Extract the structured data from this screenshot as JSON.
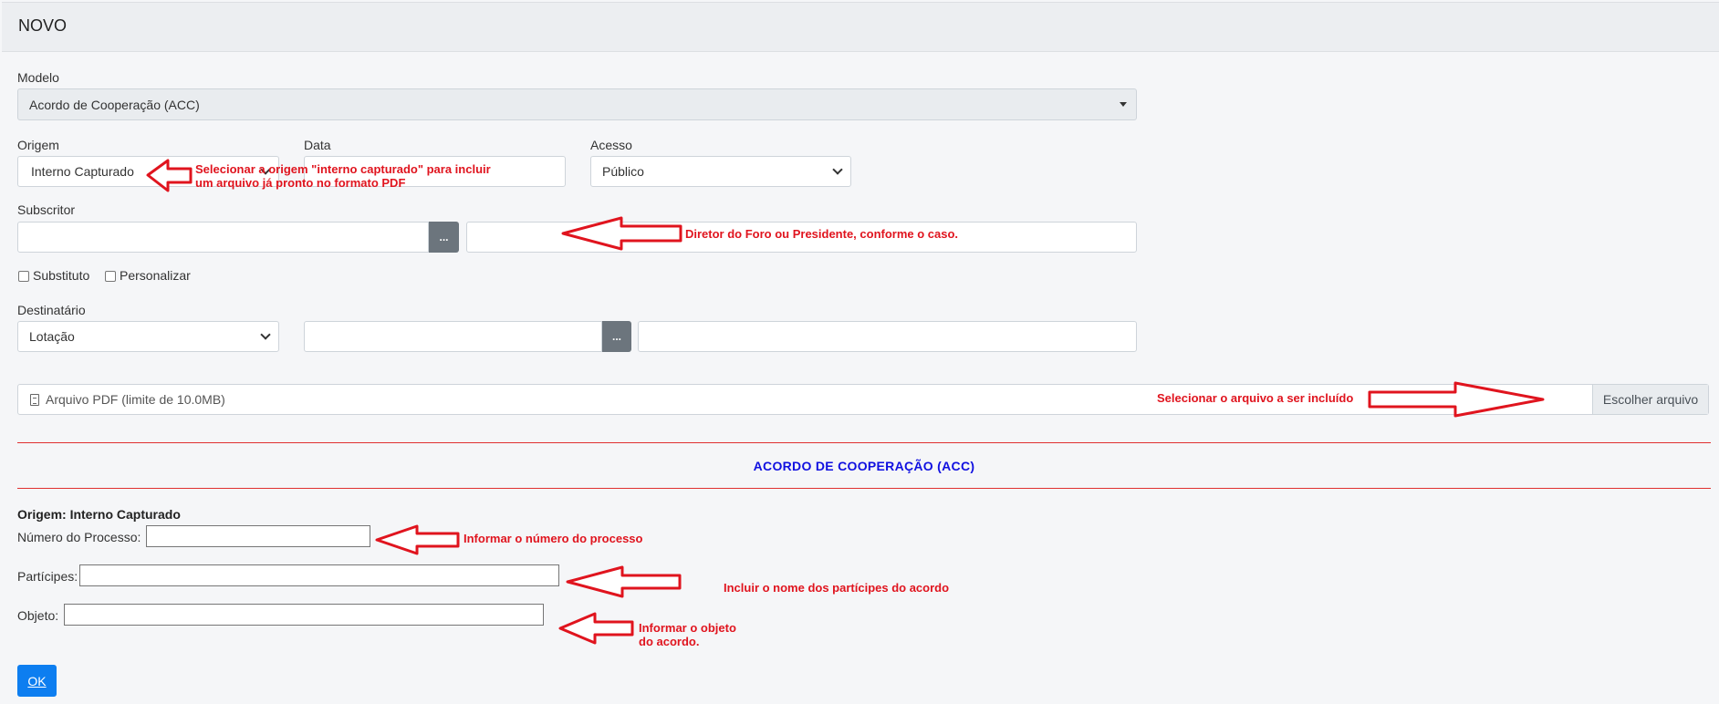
{
  "header": {
    "title": "NOVO"
  },
  "form": {
    "modelo_label": "Modelo",
    "modelo_value": "Acordo de Cooperação (ACC)",
    "origem_label": "Origem",
    "origem_value": "Interno Capturado",
    "data_label": "Data",
    "acesso_label": "Acesso",
    "acesso_value": "Público",
    "subscritor_label": "Subscritor",
    "dots": "...",
    "substituto_label": "Substituto",
    "personalizar_label": "Personalizar",
    "destinatario_label": "Destinatário",
    "destinatario_value": "Lotação",
    "arquivo_label": "Arquivo PDF (limite de 10.0MB)",
    "arquivo_button": "Escolher arquivo"
  },
  "section": {
    "title": "ACORDO DE COOPERAÇÃO (ACC)",
    "origem_line": "Origem: Interno Capturado",
    "numero_label": "Número do Processo:",
    "participes_label": "Partícipes:",
    "objeto_label": "Objeto:",
    "ok_label": "OK"
  },
  "annotations": {
    "origem_note_1": "Selecionar a origem \"interno capturado\" para incluir",
    "origem_note_2": "um arquivo já pronto no formato PDF",
    "subscritor_note": "Diretor do Foro ou Presidente, conforme o caso.",
    "arquivo_note": "Selecionar o arquivo a ser incluído",
    "numero_note": "Informar o número do processo",
    "participes_note": "Incluir o nome dos partícipes do acordo",
    "objeto_note_1": "Informar o objeto",
    "objeto_note_2": "do acordo."
  },
  "colors": {
    "annotation": "#e0141e",
    "section_title": "#1010e0",
    "primary": "#0d7ef0"
  }
}
